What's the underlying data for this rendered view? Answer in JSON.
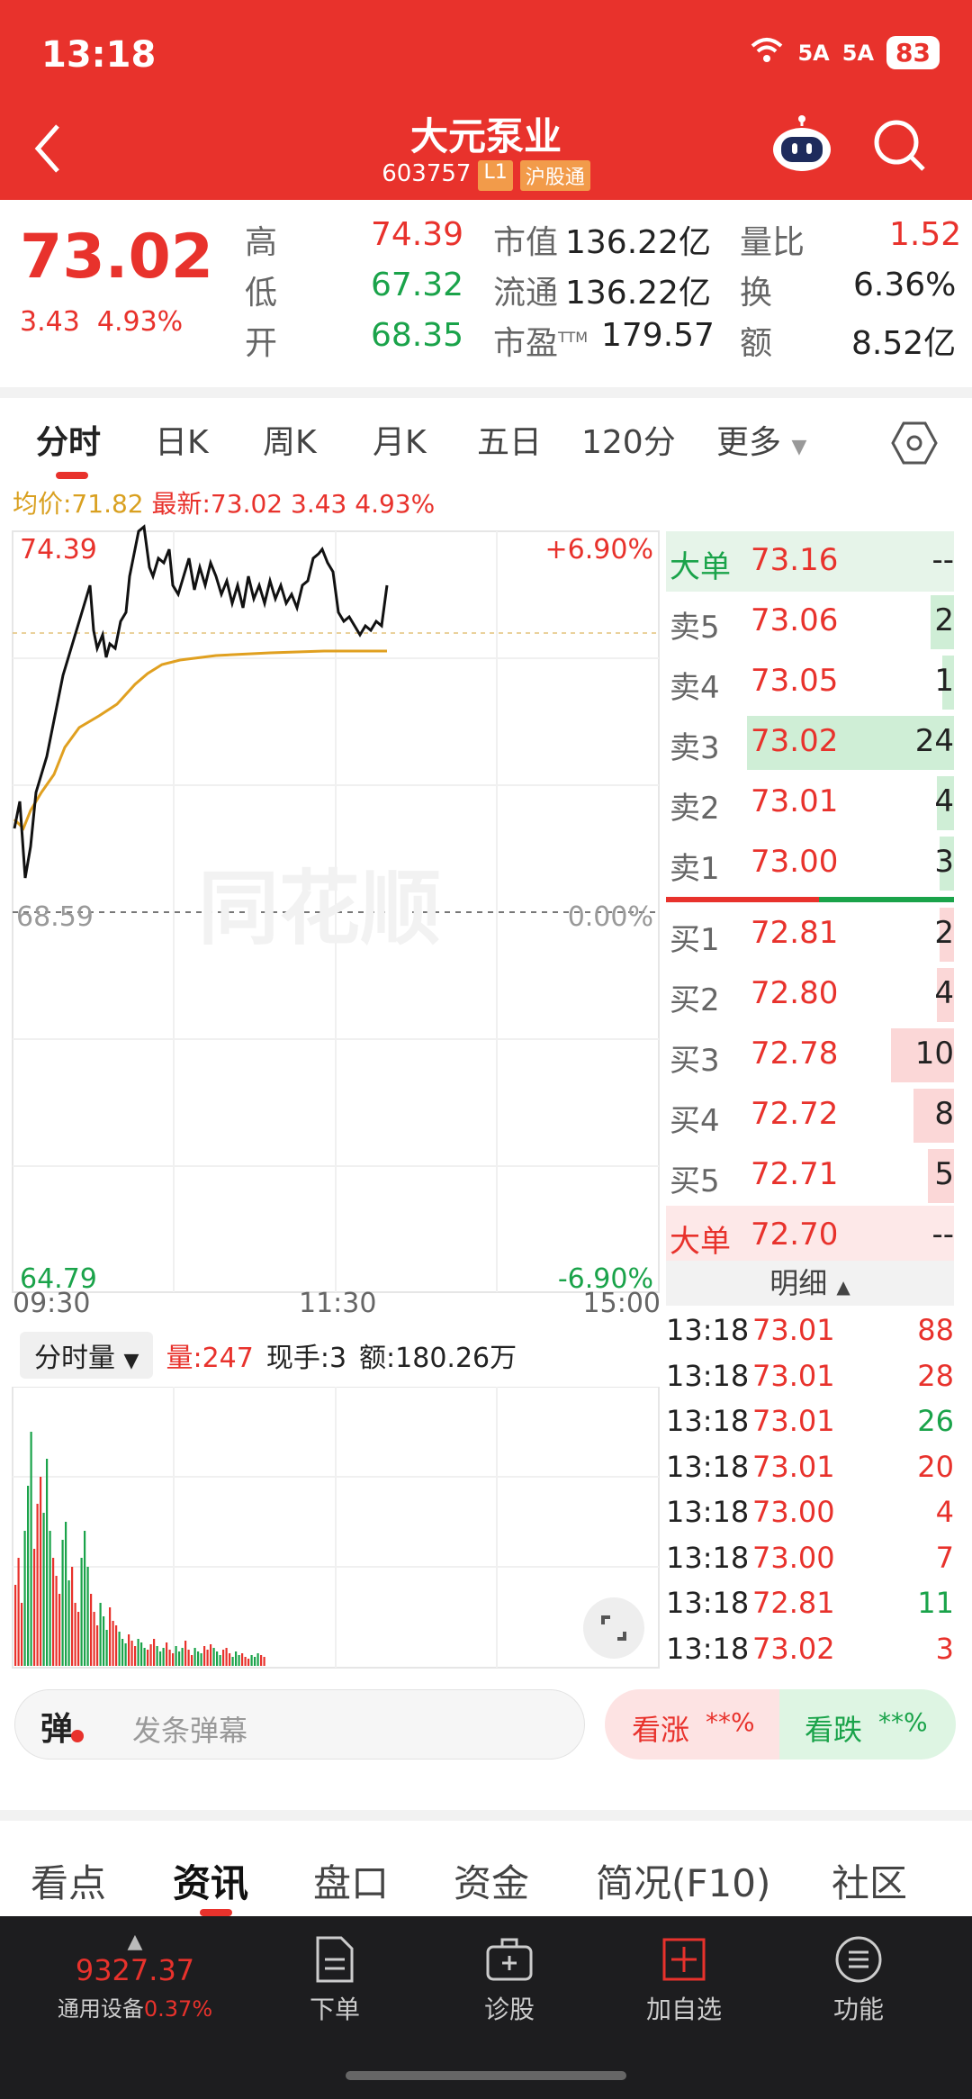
{
  "status": {
    "time": "13:18",
    "sig1": "5A",
    "sig2": "5A",
    "battery": "83"
  },
  "header": {
    "title": "大元泵业",
    "code": "603757",
    "level_tag": "L1",
    "market_tag": "沪股通"
  },
  "quote": {
    "price": "73.02",
    "change": "3.43",
    "change_pct": "4.93%",
    "high_label": "高",
    "high": "74.39",
    "low_label": "低",
    "low": "67.32",
    "open_label": "开",
    "open": "68.35",
    "mcap_label": "市值",
    "mcap": "136.22亿",
    "float_label": "流通",
    "float": "136.22亿",
    "pe_label": "市盈",
    "pe_sup": "TTM",
    "pe": "179.57",
    "vr_label": "量比",
    "vr": "1.52",
    "turn_label": "换",
    "turn": "6.36%",
    "amt_label": "额",
    "amt": "8.52亿"
  },
  "tabs": [
    "分时",
    "日K",
    "周K",
    "月K",
    "五日",
    "120分",
    "更多"
  ],
  "intraday": {
    "avg_label": "均价:71.82",
    "latest_label": "最新:73.02",
    "chg": "3.43",
    "pct": "4.93%",
    "price_max": "74.39",
    "price_mid": "68.59",
    "price_min": "64.79",
    "pct_max": "+6.90%",
    "pct_mid": "0.00%",
    "pct_min": "-6.90%",
    "times": [
      "09:30",
      "11:30",
      "15:00"
    ],
    "watermark": "同花顺"
  },
  "volume": {
    "tab_label": "分时量",
    "vol": "量:247",
    "hand": "现手:3",
    "amt": "额:180.26万"
  },
  "orderbook": {
    "big_sell": {
      "label": "大单",
      "price": "73.16",
      "vol": "--"
    },
    "sells": [
      {
        "label": "卖5",
        "price": "73.06",
        "vol": "2",
        "frac": 0.08
      },
      {
        "label": "卖4",
        "price": "73.05",
        "vol": "1",
        "frac": 0.04
      },
      {
        "label": "卖3",
        "price": "73.02",
        "vol": "24",
        "frac": 0.72
      },
      {
        "label": "卖2",
        "price": "73.01",
        "vol": "4",
        "frac": 0.06
      },
      {
        "label": "卖1",
        "price": "73.00",
        "vol": "3",
        "frac": 0.05
      }
    ],
    "buys": [
      {
        "label": "买1",
        "price": "72.81",
        "vol": "2",
        "frac": 0.05
      },
      {
        "label": "买2",
        "price": "72.80",
        "vol": "4",
        "frac": 0.06
      },
      {
        "label": "买3",
        "price": "72.78",
        "vol": "10",
        "frac": 0.22
      },
      {
        "label": "买4",
        "price": "72.72",
        "vol": "8",
        "frac": 0.14
      },
      {
        "label": "买5",
        "price": "72.71",
        "vol": "5",
        "frac": 0.09
      }
    ],
    "big_buy": {
      "label": "大单",
      "price": "72.70",
      "vol": "--"
    }
  },
  "details": {
    "label": "明细",
    "rows": [
      {
        "t": "13:18",
        "p": "73.01",
        "v": "88",
        "dir": "buy"
      },
      {
        "t": "13:18",
        "p": "73.01",
        "v": "28",
        "dir": "buy"
      },
      {
        "t": "13:18",
        "p": "73.01",
        "v": "26",
        "dir": "sell"
      },
      {
        "t": "13:18",
        "p": "73.01",
        "v": "20",
        "dir": "buy"
      },
      {
        "t": "13:18",
        "p": "73.00",
        "v": "4",
        "dir": "buy"
      },
      {
        "t": "13:18",
        "p": "73.00",
        "v": "7",
        "dir": "buy"
      },
      {
        "t": "13:18",
        "p": "72.81",
        "v": "11",
        "dir": "sell"
      },
      {
        "t": "13:18",
        "p": "73.02",
        "v": "3",
        "dir": "buy"
      }
    ]
  },
  "danmu": {
    "icon": "弹",
    "placeholder": "发条弹幕",
    "bull_label": "看涨",
    "bull_pct": "**%",
    "bear_label": "看跌",
    "bear_pct": "**%"
  },
  "bottom_tabs": [
    "看点",
    "资讯",
    "盘口",
    "资金",
    "简况(F10)",
    "社区"
  ],
  "dock": {
    "index_value": "9327.37",
    "index_name": "通用设备",
    "index_pct": "0.37%",
    "items": [
      "下单",
      "诊股",
      "加自选",
      "功能"
    ]
  },
  "colors": {
    "up": "#e8322c",
    "down": "#1aa34a",
    "avg": "#e0a020",
    "header": "#e8322c"
  }
}
